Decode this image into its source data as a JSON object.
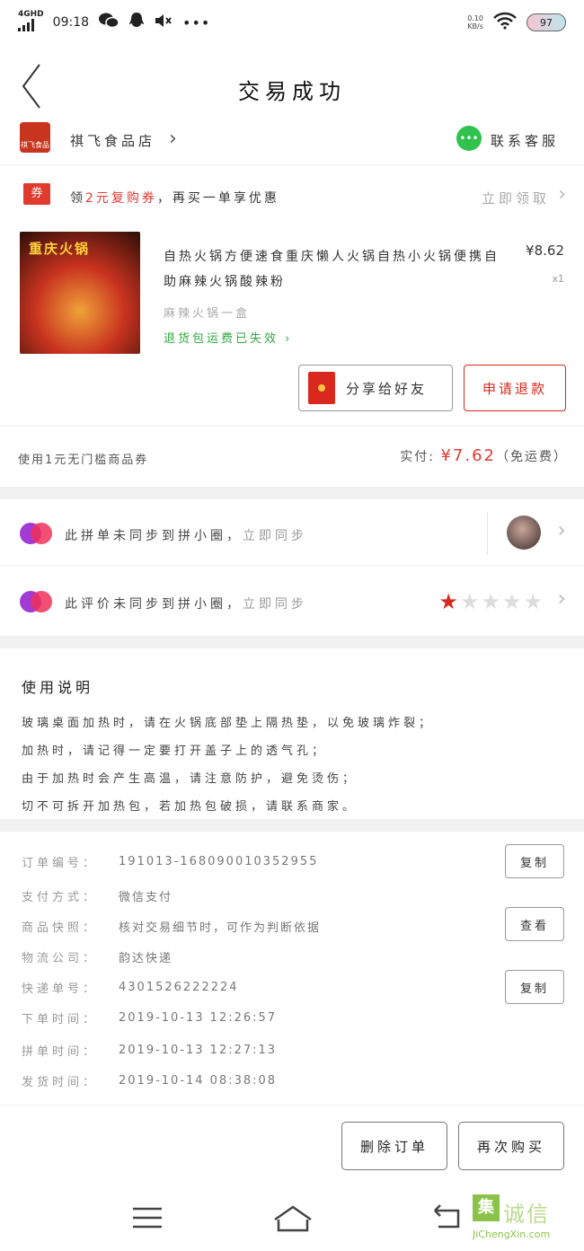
{
  "status_bar": {
    "network": "4GHD",
    "time": "09:18",
    "speed": "0.10",
    "speed_unit": "KB/s",
    "battery": "97"
  },
  "nav": {
    "title": "交易成功"
  },
  "shop": {
    "logo_text": "祺飞食品",
    "name": "祺飞食品店",
    "service_label": "联系客服"
  },
  "coupon": {
    "badge": "券",
    "text_prefix": "领",
    "text_highlight": "2元复购券",
    "text_suffix": "，再买一单享优惠",
    "action": "立即领取"
  },
  "product": {
    "image_caption": "重庆火锅",
    "name": "自热火锅方便速食重庆懒人火锅自热小火锅便携自助麻辣火锅酸辣粉",
    "price": "¥8.62",
    "quantity": "x1",
    "spec": "麻辣火锅一盒",
    "refund_note": "退货包运费已失效"
  },
  "actions": {
    "share": "分享给好友",
    "refund": "申请退款"
  },
  "totals": {
    "coupon_note": "使用1元无门槛商品券",
    "paid_label": "实付:",
    "paid_amount": "¥7.62",
    "paid_suffix": "（免运费）"
  },
  "sync": {
    "order_text": "此拼单未同步到拼小圈，",
    "order_action": "立即同步",
    "review_text": "此评价未同步到拼小圈，",
    "review_action": "立即同步",
    "rating": 1,
    "rating_max": 5,
    "brand_colors": [
      "#a13bd6",
      "#f0305a"
    ]
  },
  "instructions": {
    "title": "使用说明",
    "lines": [
      "玻璃桌面加热时，请在火锅底部垫上隔热垫，以免玻璃炸裂；",
      "加热时，请记得一定要打开盖子上的透气孔；",
      "由于加热时会产生高温，请注意防护，避免烫伤；",
      "切不可拆开加热包，若加热包破损，请联系商家。"
    ]
  },
  "order_info": {
    "rows": [
      {
        "label": "订单编号：",
        "value": "191013-168090010352955",
        "button": "复制"
      },
      {
        "label": "支付方式：",
        "value": "微信支付",
        "button": ""
      },
      {
        "label": "商品快照：",
        "value": "核对交易细节时，可作为判断依据",
        "button": "查看"
      },
      {
        "label": "物流公司：",
        "value": "韵达快递",
        "button": ""
      },
      {
        "label": "快递单号：",
        "value": "4301526222224",
        "button": "复制"
      },
      {
        "label": "下单时间：",
        "value": "2019-10-13 12:26:57",
        "button": ""
      },
      {
        "label": "拼单时间：",
        "value": "2019-10-13 12:27:13",
        "button": ""
      },
      {
        "label": "发货时间：",
        "value": "2019-10-14 08:38:08",
        "button": ""
      }
    ]
  },
  "bottom": {
    "delete": "删除订单",
    "rebuy": "再次购买"
  },
  "watermark": {
    "box": "集",
    "text": "诚信",
    "url": "JiChengXin.com"
  },
  "colors": {
    "accent_red": "#e03b2f",
    "refund_green": "#2fa83e",
    "service_green": "#30c24d"
  }
}
